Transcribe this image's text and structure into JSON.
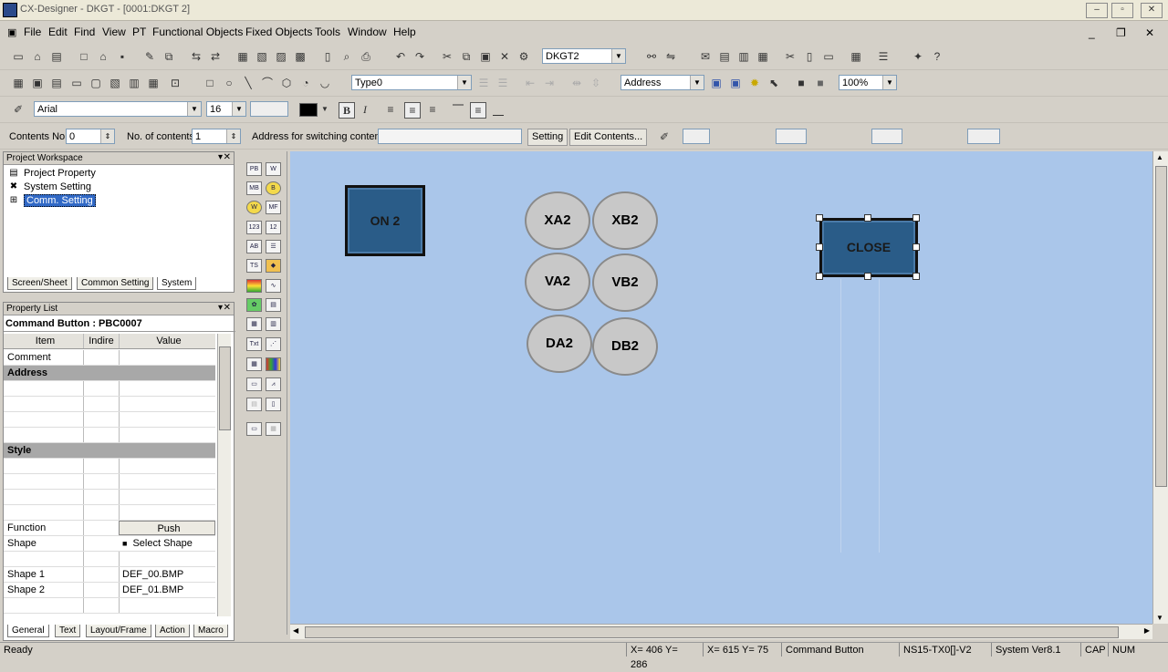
{
  "titlebar": {
    "title": "CX-Designer - DKGT - [0001:DKGT 2]"
  },
  "menu": {
    "items": [
      "File",
      "Edit",
      "Find",
      "View",
      "PT",
      "Functional Objects",
      "Fixed Objects",
      "Tools",
      "Window",
      "Help"
    ]
  },
  "toolbar1": {
    "screen_combo": "DKGT2"
  },
  "toolbar2": {
    "type_combo": "Type0",
    "address_combo": "Address",
    "zoom_combo": "100%"
  },
  "toolbar3": {
    "font_combo": "Arial",
    "size_combo": "16"
  },
  "toolbar4": {
    "contents_no_label": "Contents No",
    "contents_no_value": "0",
    "no_of_contents_label": "No. of contents",
    "no_of_contents_value": "1",
    "address_label": "Address for switching contents",
    "setting_button": "Setting",
    "edit_contents_button": "Edit Contents..."
  },
  "workspace": {
    "title": "Project Workspace",
    "items": [
      "Project Property",
      "System Setting",
      "Comm. Setting"
    ],
    "tabs": [
      "Screen/Sheet",
      "Common Setting",
      "System"
    ]
  },
  "properties": {
    "title": "Property List",
    "object": "Command Button : PBC0007",
    "headers": [
      "Item",
      "Indire",
      "Value"
    ],
    "rows": {
      "comment": "Comment",
      "address": "Address",
      "style": "Style",
      "function_item": "Function",
      "function_value": "Push",
      "shape_item": "Shape",
      "shape_value": "Select Shape",
      "shape1_item": "Shape 1",
      "shape1_value": "DEF_00.BMP",
      "shape2_item": "Shape 2",
      "shape2_value": "DEF_01.BMP"
    },
    "tabs": [
      "General",
      "Text",
      "Layout/Frame",
      "Action",
      "Macro"
    ]
  },
  "canvas": {
    "on_button": "ON 2",
    "close_button": "CLOSE",
    "lamps": [
      "XA2",
      "XB2",
      "VA2",
      "VB2",
      "DA2",
      "DB2"
    ]
  },
  "status": {
    "ready": "Ready",
    "coord1": "X= 406 Y= 286",
    "coord2": "X= 615 Y=  75",
    "object_type": "Command Button",
    "model": "NS15-TX0[]-V2",
    "version": "System Ver8.1",
    "cap": "CAP",
    "num": "NUM"
  },
  "colors": {
    "canvas_bg": "#aac6ea",
    "button_fill": "#2a5c88",
    "lamp_fill": "#c8c8c8"
  }
}
